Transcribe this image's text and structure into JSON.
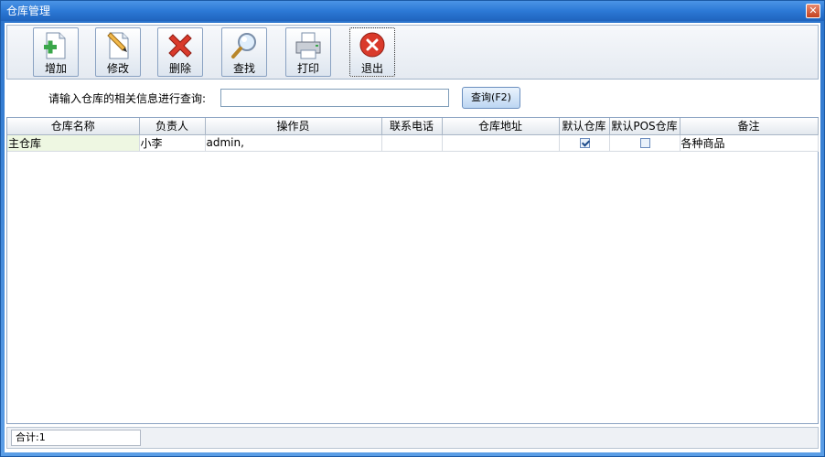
{
  "window": {
    "title": "仓库管理",
    "close_glyph": "✕"
  },
  "toolbar": {
    "buttons": [
      {
        "label": "增加",
        "icon": "add-document-icon"
      },
      {
        "label": "修改",
        "icon": "edit-document-icon"
      },
      {
        "label": "删除",
        "icon": "delete-x-icon"
      },
      {
        "label": "查找",
        "icon": "magnifier-icon"
      },
      {
        "label": "打印",
        "icon": "printer-icon"
      },
      {
        "label": "退出",
        "icon": "exit-circle-icon"
      }
    ]
  },
  "search": {
    "label": "请输入仓库的相关信息进行查询:",
    "value": "",
    "button_label": "查询(F2)"
  },
  "table": {
    "headers": [
      "仓库名称",
      "负责人",
      "操作员",
      "联系电话",
      "仓库地址",
      "默认仓库",
      "默认POS仓库",
      "备注"
    ],
    "rows": [
      {
        "name": "主仓库",
        "manager": "小李",
        "operator": "admin,",
        "phone": "",
        "address": "",
        "default": true,
        "default_pos": false,
        "remark": "各种商品"
      }
    ]
  },
  "status": {
    "total": "合计:1"
  },
  "colors": {
    "title_bar": "#2c79d6",
    "accent": "#1f63bd",
    "delete_red": "#d93a2b",
    "add_green": "#3aa64a"
  }
}
